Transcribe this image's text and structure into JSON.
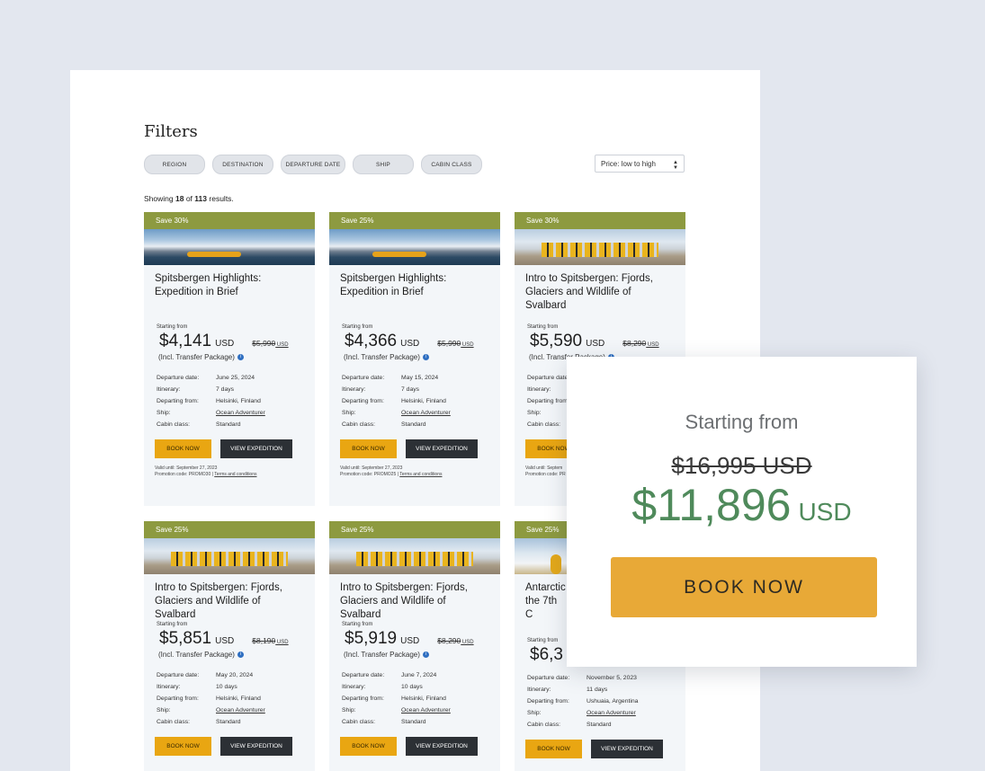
{
  "filters": {
    "title": "Filters",
    "chips": [
      "REGION",
      "DESTINATION",
      "DEPARTURE DATE",
      "SHIP",
      "CABIN CLASS"
    ],
    "sort": "Price: low to high"
  },
  "results": {
    "prefix": "Showing",
    "shown": "18",
    "of": "of",
    "total": "113",
    "suffix": "results."
  },
  "labels": {
    "starting_from": "Starting from",
    "incl": "(Incl. Transfer Package)",
    "departure_date": "Departure date:",
    "itinerary": "Itinerary:",
    "departing_from": "Departing from:",
    "ship": "Ship:",
    "cabin_class": "Cabin class:",
    "book_now": "BOOK NOW",
    "view_expedition": "VIEW EXPEDITION",
    "terms": "Terms and conditions"
  },
  "cards": [
    {
      "badge": "Save 30%",
      "title": "Spitsbergen Highlights: Expedition in Brief",
      "price": "$4,141",
      "currency": "USD",
      "old": "$5,990",
      "date": "June 25, 2024",
      "itinerary": "7 days",
      "from": "Helsinki, Finland",
      "ship": "Ocean Adventurer",
      "cabin": "Standard",
      "valid": "Valid until: September 27, 2023",
      "promo": "Promotion code: PROMO30"
    },
    {
      "badge": "Save 25%",
      "title": "Spitsbergen Highlights: Expedition in Brief",
      "price": "$4,366",
      "currency": "USD",
      "old": "$5,990",
      "date": "May 15, 2024",
      "itinerary": "7 days",
      "from": "Helsinki, Finland",
      "ship": "Ocean Adventurer",
      "cabin": "Standard",
      "valid": "Valid until: September 27, 2023",
      "promo": "Promotion code: PROMO25"
    },
    {
      "badge": "Save 30%",
      "title": "Intro to Spitsbergen: Fjords, Glaciers and Wildlife of Svalbard",
      "price": "$5,590",
      "currency": "USD",
      "old": "$8,290",
      "date": "",
      "itinerary": "",
      "from": "",
      "ship": "",
      "cabin": "",
      "valid": "Valid until: Septem",
      "promo": "Promotion code: PR"
    },
    {
      "badge": "Save 25%",
      "title": "Intro to Spitsbergen: Fjords, Glaciers and Wildlife of Svalbard",
      "price": "$5,851",
      "currency": "USD",
      "old": "$8,190",
      "date": "May 20, 2024",
      "itinerary": "10 days",
      "from": "Helsinki, Finland",
      "ship": "Ocean Adventurer",
      "cabin": "Standard",
      "valid": "",
      "promo": ""
    },
    {
      "badge": "Save 25%",
      "title": "Intro to Spitsbergen: Fjords, Glaciers and Wildlife of Svalbard",
      "price": "$5,919",
      "currency": "USD",
      "old": "$8,290",
      "date": "June 7, 2024",
      "itinerary": "10 days",
      "from": "Helsinki, Finland",
      "ship": "Ocean Adventurer",
      "cabin": "Standard",
      "valid": "",
      "promo": ""
    },
    {
      "badge": "Save 25%",
      "title": "Antarctic the 7th C",
      "price": "$6,3",
      "currency": "",
      "old": "",
      "date": "November 5, 2023",
      "itinerary": "11 days",
      "from": "Ushuaia, Argentina",
      "ship": "Ocean Adventurer",
      "cabin": "Standard",
      "valid": "",
      "promo": ""
    }
  ],
  "zoom": {
    "starting_from": "Starting from",
    "old_price": "$16,995 USD",
    "price": "$11,896",
    "currency": "USD",
    "book_now": "BOOK NOW"
  },
  "colors": {
    "badge": "#8d9a40",
    "book": "#e9a612",
    "view": "#2c3035",
    "zoom_price": "#4f8a5b",
    "zoom_book": "#e8a937"
  },
  "icons": [
    "info-icon",
    "sort-caret-icon"
  ]
}
